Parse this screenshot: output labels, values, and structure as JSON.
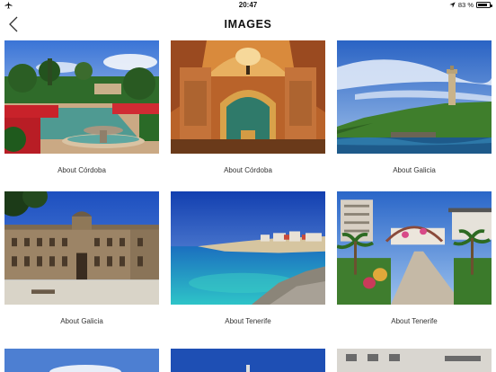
{
  "status": {
    "time": "20:47",
    "battery": "83 %",
    "battery_level": 0.83,
    "left_icon": "airplane-icon",
    "right_icon": "location-arrow-icon"
  },
  "header": {
    "title": "IMAGES",
    "back_icon": "chevron-left-icon"
  },
  "images": [
    {
      "caption": "About Córdoba"
    },
    {
      "caption": "About Córdoba"
    },
    {
      "caption": "About Galicia"
    },
    {
      "caption": "About Galicia"
    },
    {
      "caption": "About Tenerife"
    },
    {
      "caption": "About Tenerife"
    }
  ],
  "colors": {
    "sky": "#3b6fd1",
    "sea": "#1aa5c6",
    "foliage": "#2f7a2e",
    "stone": "#b89a6a",
    "text": "#333333"
  }
}
